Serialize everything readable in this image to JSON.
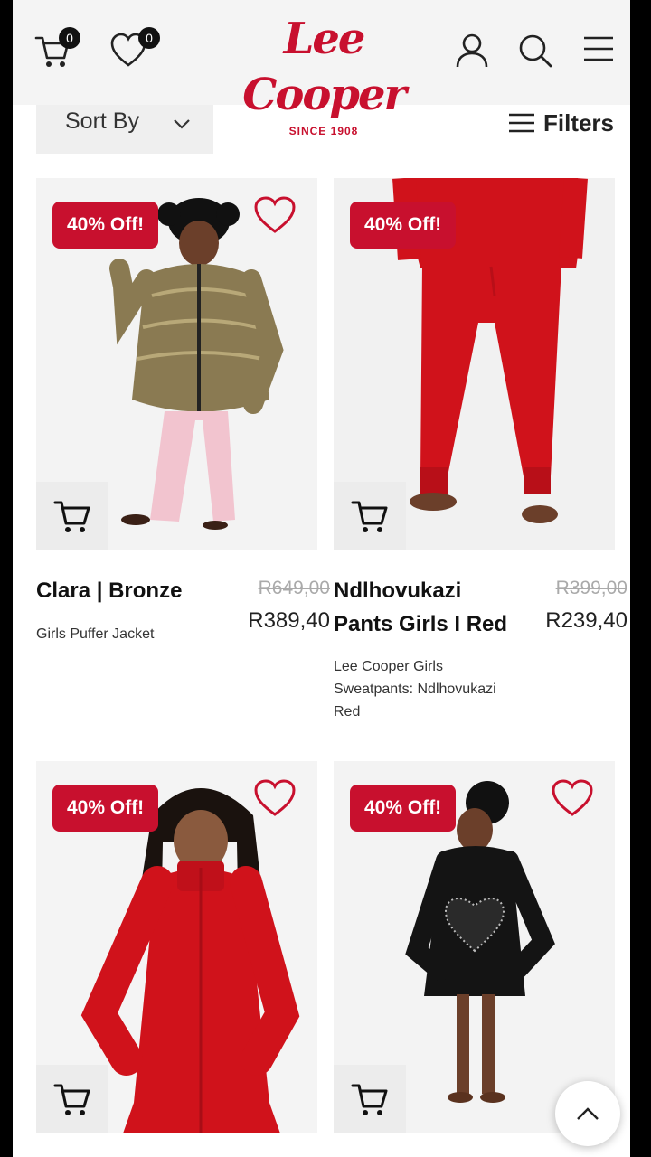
{
  "header": {
    "cart_count": "0",
    "wishlist_count": "0",
    "logo_text": "Lee Cooper",
    "logo_subtitle": "SINCE 1908",
    "icons": [
      "cart-icon",
      "heart-icon",
      "user-icon",
      "search-icon",
      "menu-icon"
    ]
  },
  "toolbar": {
    "sort_label": "Sort By",
    "filters_label": "Filters"
  },
  "products": [
    {
      "discount": "40% Off!",
      "name": "Clara | Bronze",
      "description": "Girls Puffer Jacket",
      "old_price": "R649,00",
      "price": "R389,40"
    },
    {
      "discount": "40% Off!",
      "name": "Ndlhovukazi Pants Girls I Red",
      "description": "Lee Cooper Girls Sweatpants: Ndlhovukazi Red",
      "old_price": "R399,00",
      "price": "R239,40"
    },
    {
      "discount": "40% Off!"
    },
    {
      "discount": "40% Off!"
    }
  ],
  "colors": {
    "brand_red": "#c8102e",
    "product_red": "#d0121b",
    "bronze": "#8a7a52"
  }
}
